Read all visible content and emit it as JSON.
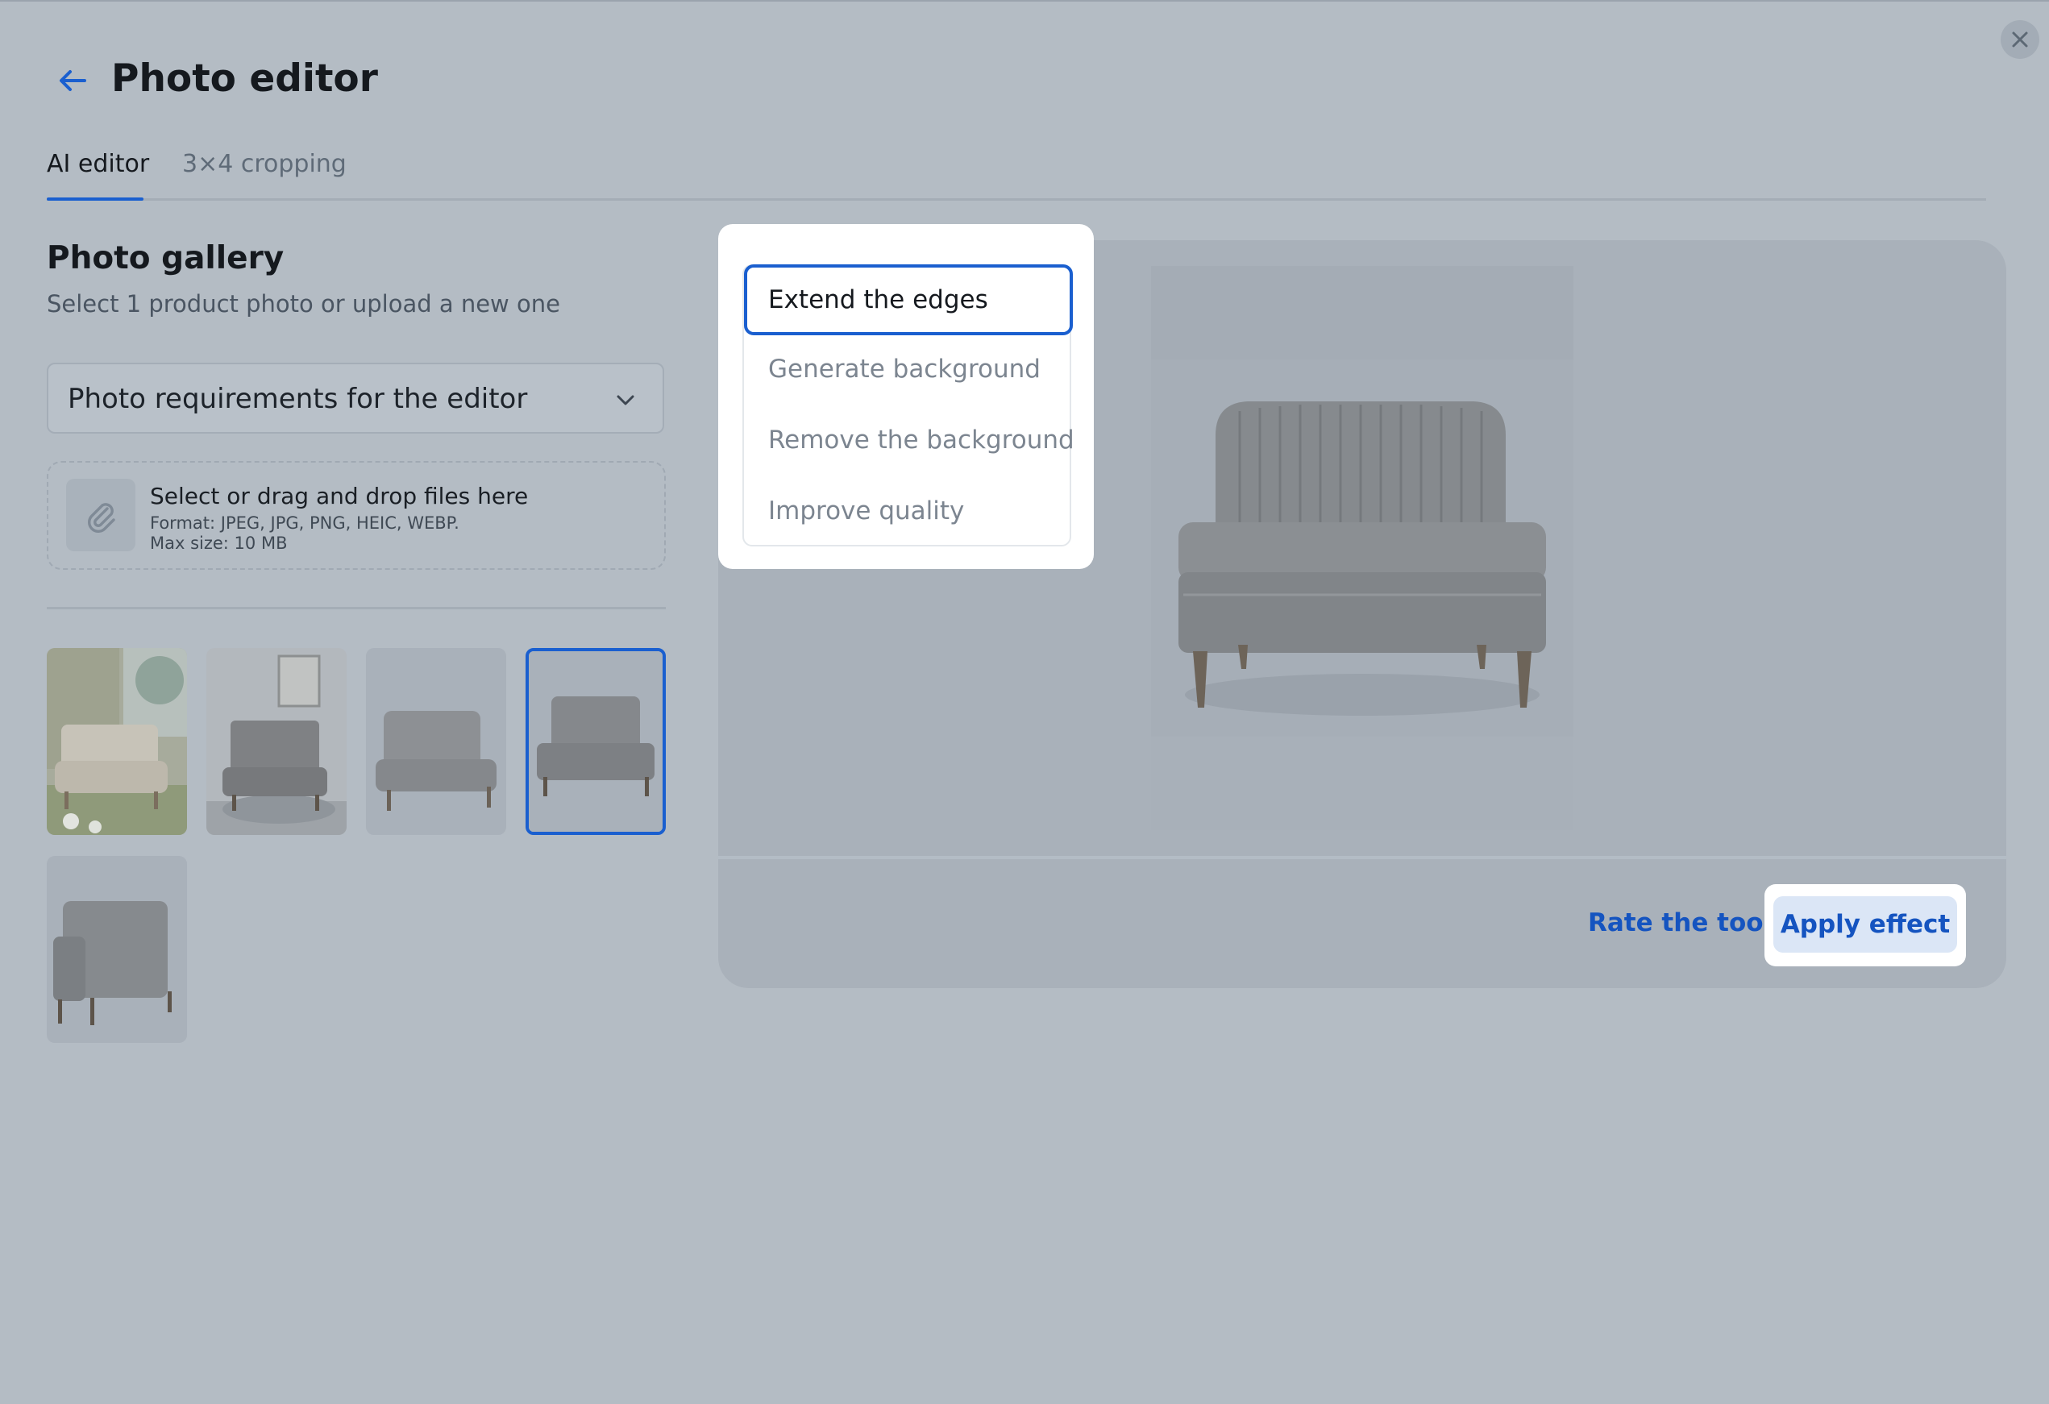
{
  "header": {
    "title": "Photo editor",
    "back_icon": "arrow-left-icon",
    "close_icon": "close-icon"
  },
  "tabs": [
    {
      "label": "AI editor",
      "active": true
    },
    {
      "label": "3×4 cropping",
      "active": false
    }
  ],
  "gallery": {
    "title": "Photo gallery",
    "subtitle": "Select 1 product photo or upload a new one",
    "requirements_dropdown": "Photo requirements for the editor",
    "upload": {
      "title": "Select or drag and drop files here",
      "format": "Format: JPEG, JPG, PNG, HEIC, WEBP.",
      "max_size": "Max size: 10 MB"
    },
    "selected_index": 3,
    "thumbnail_count": 5
  },
  "effects_menu": {
    "items": [
      {
        "label": "Extend the edges",
        "active": true
      },
      {
        "label": "Generate background",
        "active": false
      },
      {
        "label": "Remove the background",
        "active": false
      },
      {
        "label": "Improve quality",
        "active": false
      }
    ]
  },
  "actions": {
    "rate_label": "Rate the tool",
    "apply_label": "Apply effect"
  },
  "colors": {
    "accent": "#1a5fcf",
    "overlay_background": "#b4bcc4",
    "link": "#1554c0"
  }
}
